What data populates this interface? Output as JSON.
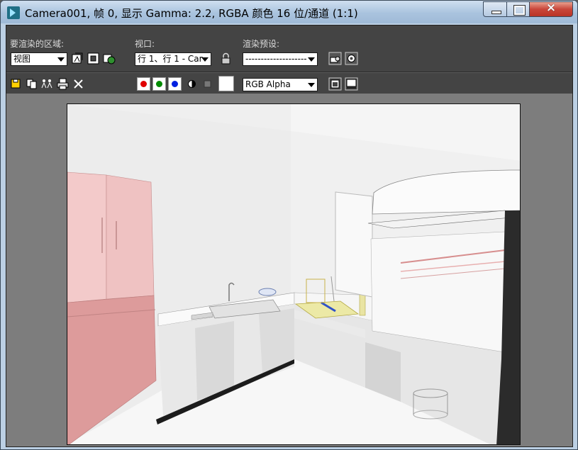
{
  "window": {
    "title": "Camera001, 帧 0, 显示 Gamma: 2.2, RGBA 颜色 16 位/通道 (1:1)",
    "icon": "3dsmax-app-icon",
    "controls": {
      "minimize": "minimize-icon",
      "maximize": "maximize-icon",
      "close": "×"
    }
  },
  "toolbar": {
    "area_label": "要渲染的区域:",
    "area_value": "视图",
    "viewport_label": "视口:",
    "viewport_value": "行 1、行 1 - Car",
    "preset_label": "渲染预设:",
    "preset_value": "--------------------",
    "channel_value": "RGB Alpha",
    "red_color": "#e00000",
    "green_color": "#008a00",
    "blue_color": "#0020e0"
  }
}
